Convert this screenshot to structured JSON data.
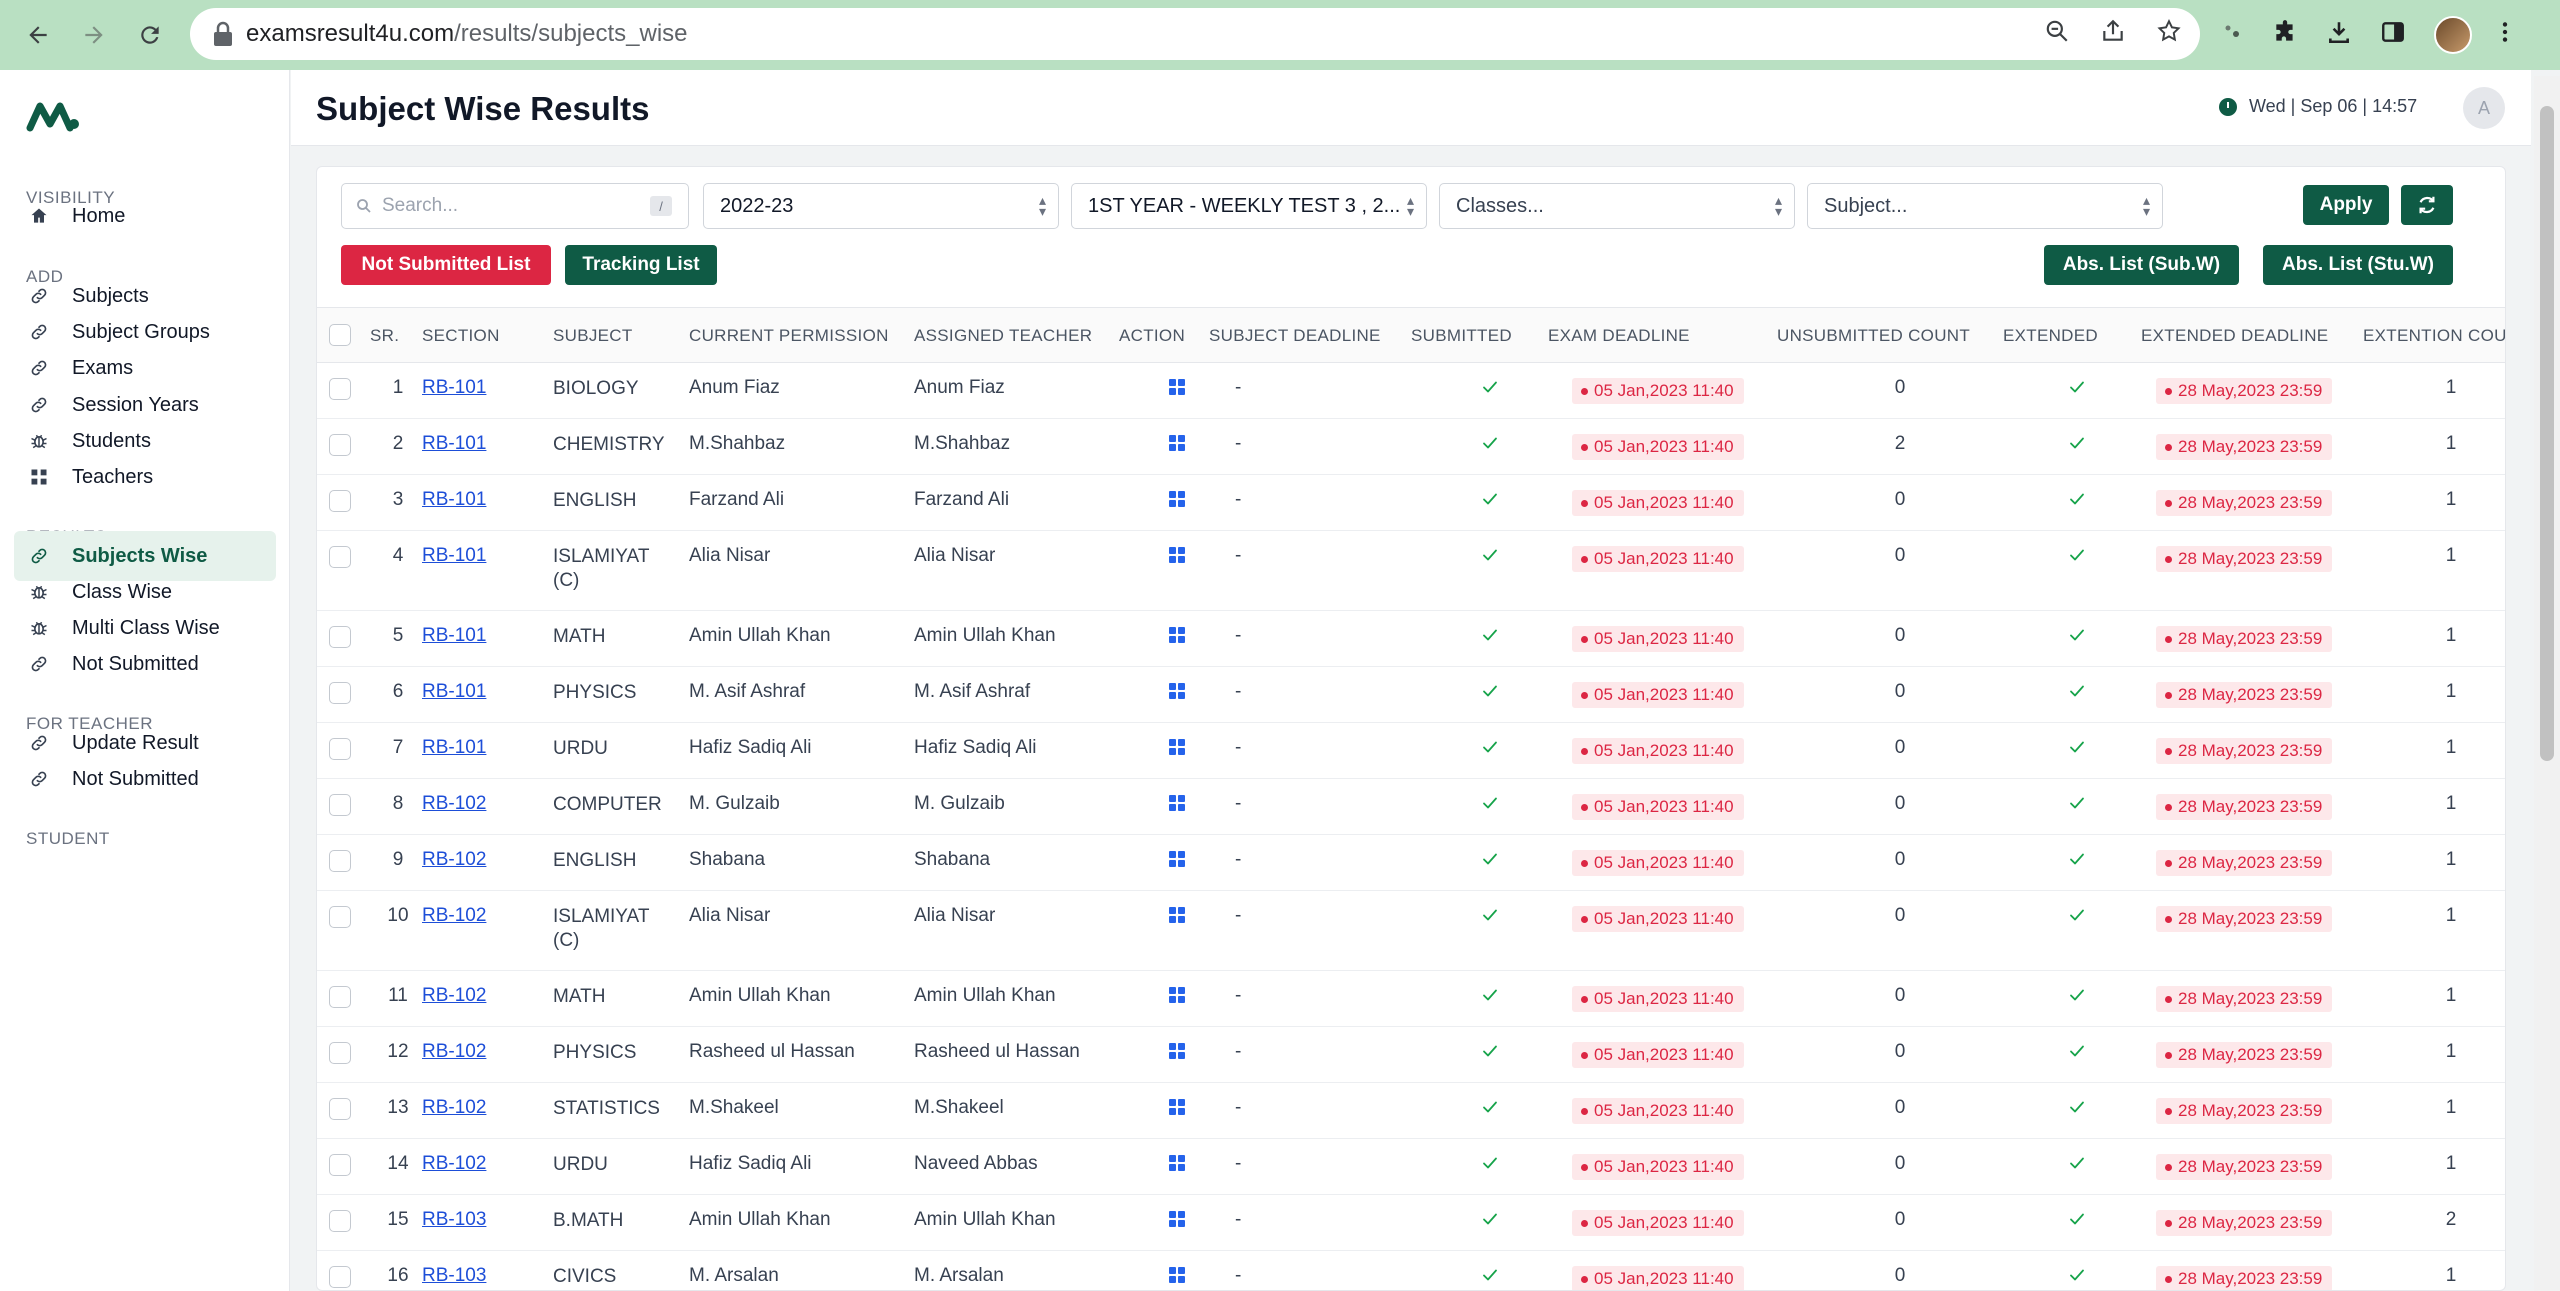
{
  "browser": {
    "url_host": "examsresult4u.com",
    "url_path": "/results/subjects_wise"
  },
  "sidebar": {
    "sections": [
      {
        "label": "VISIBILITY",
        "items": [
          {
            "label": "Home",
            "icon": "home-icon"
          }
        ]
      },
      {
        "label": "ADD",
        "items": [
          {
            "label": "Subjects",
            "icon": "link-icon"
          },
          {
            "label": "Subject Groups",
            "icon": "link-icon"
          },
          {
            "label": "Exams",
            "icon": "link-icon"
          },
          {
            "label": "Session Years",
            "icon": "link-icon"
          },
          {
            "label": "Students",
            "icon": "bug-icon"
          },
          {
            "label": "Teachers",
            "icon": "grid-icon"
          }
        ]
      },
      {
        "label": "RESULTS",
        "items": [
          {
            "label": "Subjects Wise",
            "icon": "link-icon",
            "active": true
          },
          {
            "label": "Class Wise",
            "icon": "bug-icon"
          },
          {
            "label": "Multi Class Wise",
            "icon": "bug-icon"
          },
          {
            "label": "Not Submitted",
            "icon": "link-icon"
          }
        ]
      },
      {
        "label": "FOR TEACHER",
        "items": [
          {
            "label": "Update Result",
            "icon": "link-icon"
          },
          {
            "label": "Not Submitted",
            "icon": "link-icon"
          }
        ]
      },
      {
        "label": "STUDENT",
        "items": []
      }
    ]
  },
  "header": {
    "title": "Subject Wise Results",
    "datetime": "Wed | Sep 06 | 14:57",
    "avatar_initial": "A"
  },
  "filters": {
    "search_placeholder": "Search...",
    "search_shortcut": "/",
    "session": "2022-23",
    "exam": "1ST YEAR - WEEKLY TEST 3 , 2...",
    "classes_placeholder": "Classes...",
    "subject_placeholder": "Subject...",
    "apply_label": "Apply"
  },
  "actions": {
    "not_submitted": "Not Submitted List",
    "tracking": "Tracking List",
    "abs_sub": "Abs. List (Sub.W)",
    "abs_stu": "Abs. List (Stu.W)"
  },
  "colors": {
    "brand": "#0f5b45",
    "danger": "#dc2643",
    "link": "#1d4ed8",
    "success": "#16a34a"
  },
  "table": {
    "columns": [
      "SR.",
      "SECTION",
      "SUBJECT",
      "CURRENT PERMISSION",
      "ASSIGNED TEACHER",
      "ACTION",
      "SUBJECT DEADLINE",
      "SUBMITTED",
      "EXAM DEADLINE",
      "UNSUBMITTED COUNT",
      "EXTENDED",
      "EXTENDED DEADLINE",
      "EXTENTION COUN"
    ],
    "rows": [
      {
        "sr": "1",
        "section": "RB-101",
        "subject": "BIOLOGY",
        "subject2": "",
        "permission": "Anum Fiaz",
        "teacher": "Anum Fiaz",
        "subject_deadline": "-",
        "exam_deadline": "05 Jan,2023 11:40",
        "unsubmitted": "0",
        "extended_deadline": "28 May,2023 23:59",
        "ext_count": "1"
      },
      {
        "sr": "2",
        "section": "RB-101",
        "subject": "CHEMISTRY",
        "subject2": "",
        "permission": "M.Shahbaz",
        "teacher": "M.Shahbaz",
        "subject_deadline": "-",
        "exam_deadline": "05 Jan,2023 11:40",
        "unsubmitted": "2",
        "extended_deadline": "28 May,2023 23:59",
        "ext_count": "1"
      },
      {
        "sr": "3",
        "section": "RB-101",
        "subject": "ENGLISH",
        "subject2": "",
        "permission": "Farzand Ali",
        "teacher": "Farzand Ali",
        "subject_deadline": "-",
        "exam_deadline": "05 Jan,2023 11:40",
        "unsubmitted": "0",
        "extended_deadline": "28 May,2023 23:59",
        "ext_count": "1"
      },
      {
        "sr": "4",
        "section": "RB-101",
        "subject": "ISLAMIYAT",
        "subject2": "(C)",
        "permission": "Alia Nisar",
        "teacher": "Alia Nisar",
        "subject_deadline": "-",
        "exam_deadline": "05 Jan,2023 11:40",
        "unsubmitted": "0",
        "extended_deadline": "28 May,2023 23:59",
        "ext_count": "1"
      },
      {
        "sr": "5",
        "section": "RB-101",
        "subject": "MATH",
        "subject2": "",
        "permission": "Amin Ullah Khan",
        "teacher": "Amin Ullah Khan",
        "subject_deadline": "-",
        "exam_deadline": "05 Jan,2023 11:40",
        "unsubmitted": "0",
        "extended_deadline": "28 May,2023 23:59",
        "ext_count": "1"
      },
      {
        "sr": "6",
        "section": "RB-101",
        "subject": "PHYSICS",
        "subject2": "",
        "permission": "M. Asif Ashraf",
        "teacher": "M. Asif Ashraf",
        "subject_deadline": "-",
        "exam_deadline": "05 Jan,2023 11:40",
        "unsubmitted": "0",
        "extended_deadline": "28 May,2023 23:59",
        "ext_count": "1"
      },
      {
        "sr": "7",
        "section": "RB-101",
        "subject": "URDU",
        "subject2": "",
        "permission": "Hafiz Sadiq Ali",
        "teacher": "Hafiz Sadiq Ali",
        "subject_deadline": "-",
        "exam_deadline": "05 Jan,2023 11:40",
        "unsubmitted": "0",
        "extended_deadline": "28 May,2023 23:59",
        "ext_count": "1"
      },
      {
        "sr": "8",
        "section": "RB-102",
        "subject": "COMPUTER",
        "subject2": "",
        "permission": "M. Gulzaib",
        "teacher": "M. Gulzaib",
        "subject_deadline": "-",
        "exam_deadline": "05 Jan,2023 11:40",
        "unsubmitted": "0",
        "extended_deadline": "28 May,2023 23:59",
        "ext_count": "1"
      },
      {
        "sr": "9",
        "section": "RB-102",
        "subject": "ENGLISH",
        "subject2": "",
        "permission": "Shabana",
        "teacher": "Shabana",
        "subject_deadline": "-",
        "exam_deadline": "05 Jan,2023 11:40",
        "unsubmitted": "0",
        "extended_deadline": "28 May,2023 23:59",
        "ext_count": "1"
      },
      {
        "sr": "10",
        "section": "RB-102",
        "subject": "ISLAMIYAT",
        "subject2": "(C)",
        "permission": "Alia Nisar",
        "teacher": "Alia Nisar",
        "subject_deadline": "-",
        "exam_deadline": "05 Jan,2023 11:40",
        "unsubmitted": "0",
        "extended_deadline": "28 May,2023 23:59",
        "ext_count": "1"
      },
      {
        "sr": "11",
        "section": "RB-102",
        "subject": "MATH",
        "subject2": "",
        "permission": "Amin Ullah Khan",
        "teacher": "Amin Ullah Khan",
        "subject_deadline": "-",
        "exam_deadline": "05 Jan,2023 11:40",
        "unsubmitted": "0",
        "extended_deadline": "28 May,2023 23:59",
        "ext_count": "1"
      },
      {
        "sr": "12",
        "section": "RB-102",
        "subject": "PHYSICS",
        "subject2": "",
        "permission": "Rasheed ul Hassan",
        "teacher": "Rasheed ul Hassan",
        "subject_deadline": "-",
        "exam_deadline": "05 Jan,2023 11:40",
        "unsubmitted": "0",
        "extended_deadline": "28 May,2023 23:59",
        "ext_count": "1"
      },
      {
        "sr": "13",
        "section": "RB-102",
        "subject": "STATISTICS",
        "subject2": "",
        "permission": "M.Shakeel",
        "teacher": "M.Shakeel",
        "subject_deadline": "-",
        "exam_deadline": "05 Jan,2023 11:40",
        "unsubmitted": "0",
        "extended_deadline": "28 May,2023 23:59",
        "ext_count": "1"
      },
      {
        "sr": "14",
        "section": "RB-102",
        "subject": "URDU",
        "subject2": "",
        "permission": "Hafiz Sadiq Ali",
        "teacher": "Naveed Abbas",
        "subject_deadline": "-",
        "exam_deadline": "05 Jan,2023 11:40",
        "unsubmitted": "0",
        "extended_deadline": "28 May,2023 23:59",
        "ext_count": "1"
      },
      {
        "sr": "15",
        "section": "RB-103",
        "subject": "B.MATH",
        "subject2": "",
        "permission": "Amin Ullah Khan",
        "teacher": "Amin Ullah Khan",
        "subject_deadline": "-",
        "exam_deadline": "05 Jan,2023 11:40",
        "unsubmitted": "0",
        "extended_deadline": "28 May,2023 23:59",
        "ext_count": "2"
      },
      {
        "sr": "16",
        "section": "RB-103",
        "subject": "CIVICS",
        "subject2": "",
        "permission": "M. Arsalan",
        "teacher": "M. Arsalan",
        "subject_deadline": "-",
        "exam_deadline": "05 Jan,2023 11:40",
        "unsubmitted": "0",
        "extended_deadline": "28 May,2023 23:59",
        "ext_count": "1"
      }
    ]
  }
}
